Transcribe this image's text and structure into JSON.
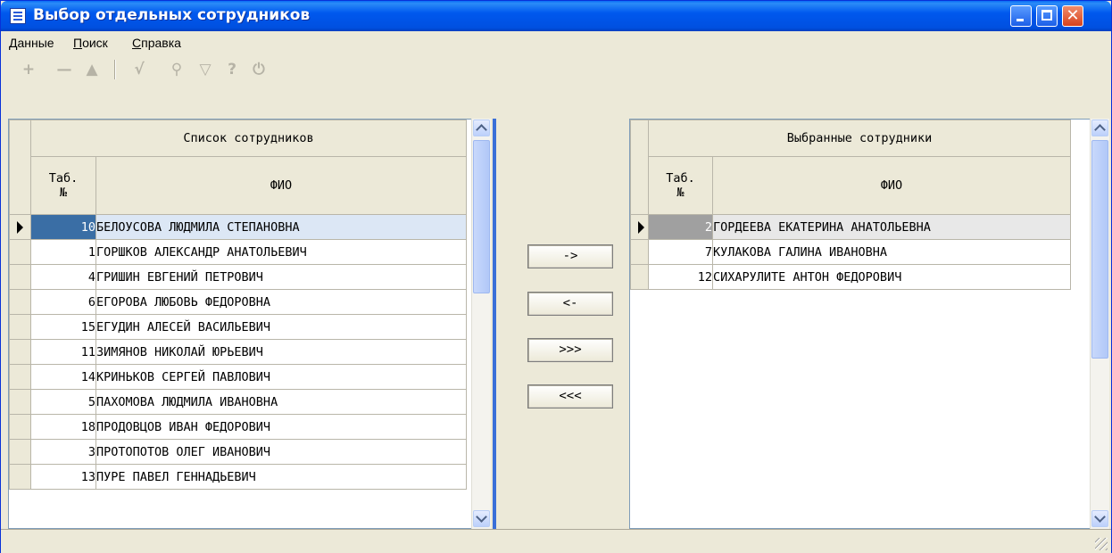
{
  "window": {
    "title": "Выбор отдельных сотрудников",
    "title_color": "#0058ee"
  },
  "menu": {
    "items": [
      {
        "first": "Д",
        "rest": "анные"
      },
      {
        "first": "П",
        "rest": "оиск"
      },
      {
        "first": "С",
        "rest": "правка"
      }
    ]
  },
  "toolbar": {
    "icons": [
      "add-icon",
      "remove-icon",
      "up-icon",
      "check-icon",
      "find-icon",
      "filter-icon",
      "help-icon",
      "exit-icon"
    ],
    "add": "+",
    "remove": "—",
    "up": "▲",
    "check": "√",
    "find": "⚲",
    "filter": "▽",
    "help": "?",
    "exit": "⏻"
  },
  "left_grid": {
    "caption": "Список сотрудников",
    "col_num_line1": "Таб.",
    "col_num_line2": "№",
    "col_name": "ФИО",
    "rows": [
      {
        "num": "10",
        "name": "БЕЛОУСОВА ЛЮДМИЛА СТЕПАНОВНА"
      },
      {
        "num": "1",
        "name": "ГОРШКОВ АЛЕКСАНДР АНАТОЛЬЕВИЧ"
      },
      {
        "num": "4",
        "name": "ГРИШИН ЕВГЕНИЙ ПЕТРОВИЧ"
      },
      {
        "num": "6",
        "name": "ЕГОРОВА ЛЮБОВЬ ФЕДОРОВНА"
      },
      {
        "num": "15",
        "name": "ЕГУДИН АЛЕСЕЙ ВАСИЛЬЕВИЧ"
      },
      {
        "num": "11",
        "name": "ЗИМЯНОВ НИКОЛАЙ ЮРЬЕВИЧ"
      },
      {
        "num": "14",
        "name": "КРИНЬКОВ СЕРГЕЙ ПАВЛОВИЧ"
      },
      {
        "num": "5",
        "name": "ПАХОМОВА ЛЮДМИЛА ИВАНОВНА"
      },
      {
        "num": "18",
        "name": "ПРОДОВЦОВ ИВАН ФЕДОРОВИЧ"
      },
      {
        "num": "3",
        "name": "ПРОТОПОТОВ ОЛЕГ ИВАНОВИЧ"
      },
      {
        "num": "13",
        "name": "ПУРЕ ПАВЕЛ ГЕННАДЬЕВИЧ"
      }
    ]
  },
  "right_grid": {
    "caption": "Выбранные сотрудники",
    "col_num_line1": "Таб.",
    "col_num_line2": "№",
    "col_name": "ФИО",
    "rows": [
      {
        "num": "2",
        "name": "ГОРДЕЕВА ЕКАТЕРИНА АНАТОЛЬЕВНА"
      },
      {
        "num": "7",
        "name": "КУЛАКОВА ГАЛИНА ИВАНОВНА"
      },
      {
        "num": "12",
        "name": "СИХАРУЛИТЕ АНТОН ФЕДОРОВИЧ"
      }
    ]
  },
  "transfer": {
    "move_right": "->",
    "move_left": "<-",
    "move_all_right": ">>>",
    "move_all_left": "<<<"
  }
}
